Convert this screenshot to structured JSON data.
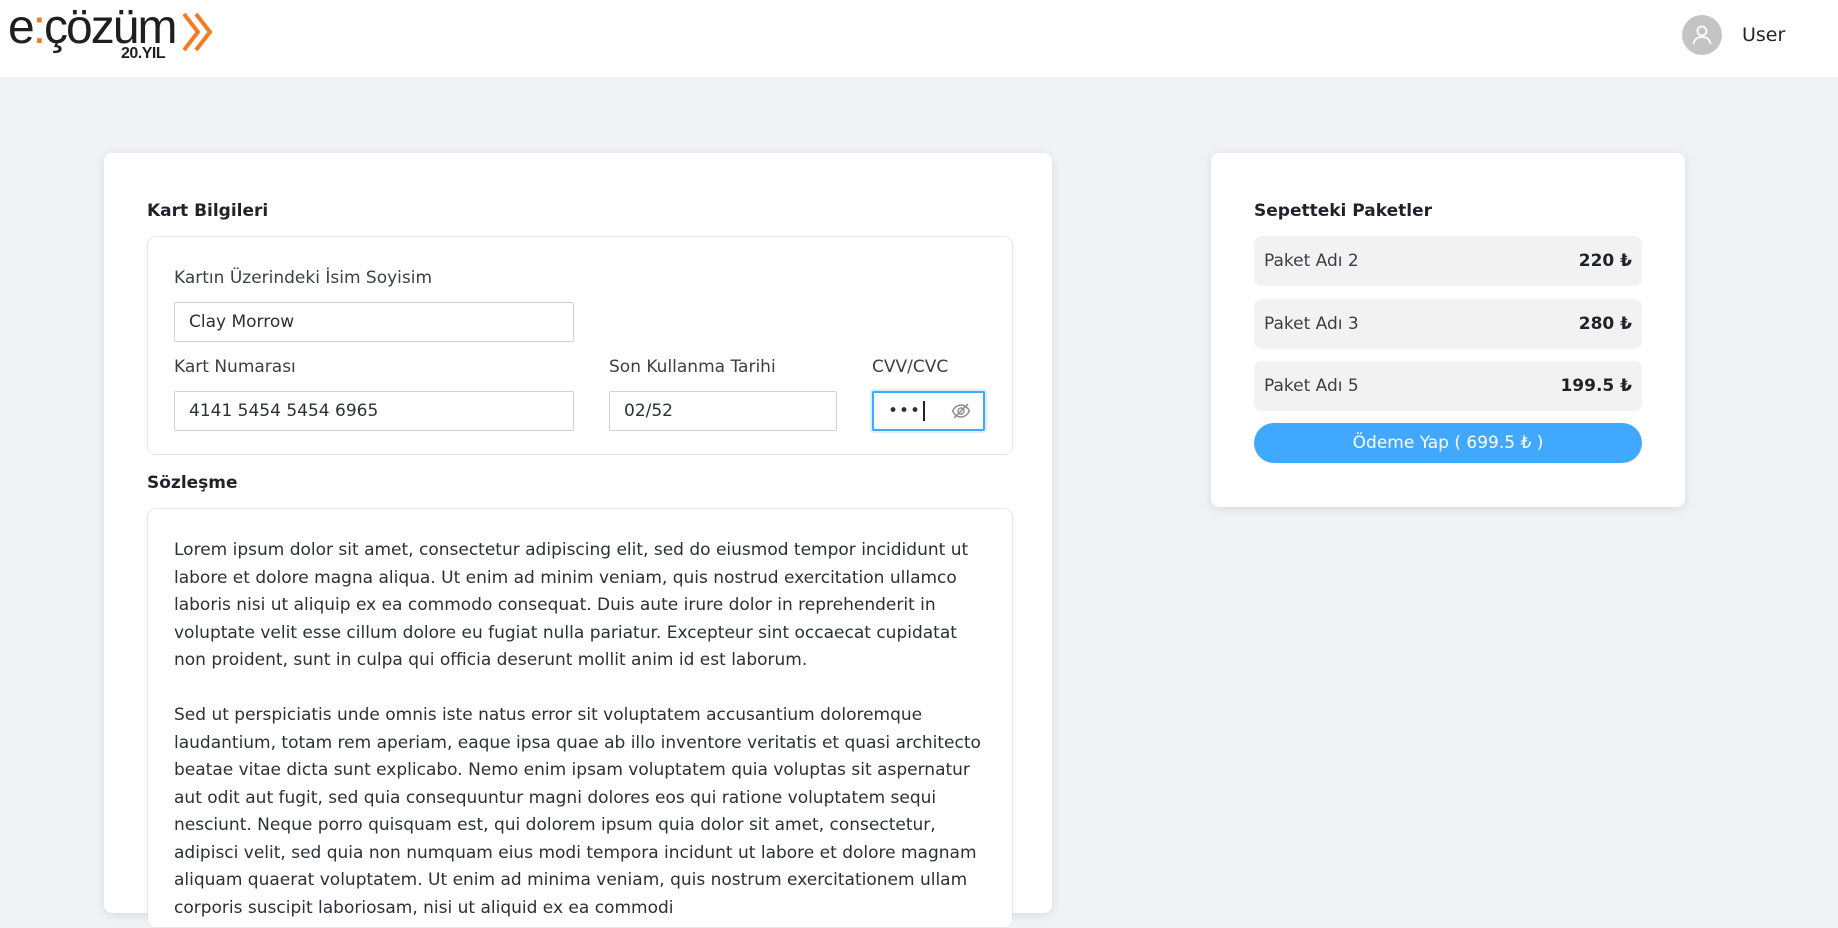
{
  "header": {
    "logo_main_left": "e",
    "logo_colon": ":",
    "logo_main_right": "çözüm",
    "logo_sub": "20.YIL",
    "user_name": "User",
    "colors": {
      "logo_accent": "#f47b20",
      "avatar_bg": "#c4c4c4"
    },
    "icons": {
      "avatar": "user-icon",
      "logo": "chevrons-right-icon"
    }
  },
  "card_info": {
    "title": "Kart Bilgileri",
    "name_label": "Kartın Üzerindeki İsim Soyisim",
    "name_value": "Clay Morrow",
    "number_label": "Kart Numarası",
    "number_value": "4141 5454 5454 6965",
    "expiry_label": "Son Kullanma Tarihi",
    "expiry_value": "02/52",
    "cvv_label": "CVV/CVC",
    "cvv_value_masked": "•••",
    "cvv_toggle_icon": "eye-off-icon"
  },
  "agreement": {
    "title": "Sözleşme",
    "paragraphs": [
      "Lorem ipsum dolor sit amet, consectetur adipiscing elit, sed do eiusmod tempor incididunt ut labore et dolore magna aliqua. Ut enim ad minim veniam, quis nostrud exercitation ullamco laboris nisi ut aliquip ex ea commodo consequat. Duis aute irure dolor in reprehenderit in voluptate velit esse cillum dolore eu fugiat nulla pariatur. Excepteur sint occaecat cupidatat non proident, sunt in culpa qui officia deserunt mollit anim id est laborum.",
      "Sed ut perspiciatis unde omnis iste natus error sit voluptatem accusantium doloremque laudantium, totam rem aperiam, eaque ipsa quae ab illo inventore veritatis et quasi architecto beatae vitae dicta sunt explicabo. Nemo enim ipsam voluptatem quia voluptas sit aspernatur aut odit aut fugit, sed quia consequuntur magni dolores eos qui ratione voluptatem sequi nesciunt. Neque porro quisquam est, qui dolorem ipsum quia dolor sit amet, consectetur, adipisci velit, sed quia non numquam eius modi tempora incidunt ut labore et dolore magnam aliquam quaerat voluptatem. Ut enim ad minima veniam, quis nostrum exercitationem ullam corporis suscipit laboriosam, nisi ut aliquid ex ea commodi"
    ]
  },
  "cart": {
    "title": "Sepetteki Paketler",
    "packages": [
      {
        "name": "Paket Adı 2",
        "price": "220 ₺"
      },
      {
        "name": "Paket Adı 3",
        "price": "280 ₺"
      },
      {
        "name": "Paket Adı 5",
        "price": "199.5 ₺"
      }
    ],
    "pay_button_label": "Ödeme Yap ( 699.5 ₺ )",
    "colors": {
      "primary": "#40a9ff",
      "package_bg": "#f2f2f2"
    }
  }
}
